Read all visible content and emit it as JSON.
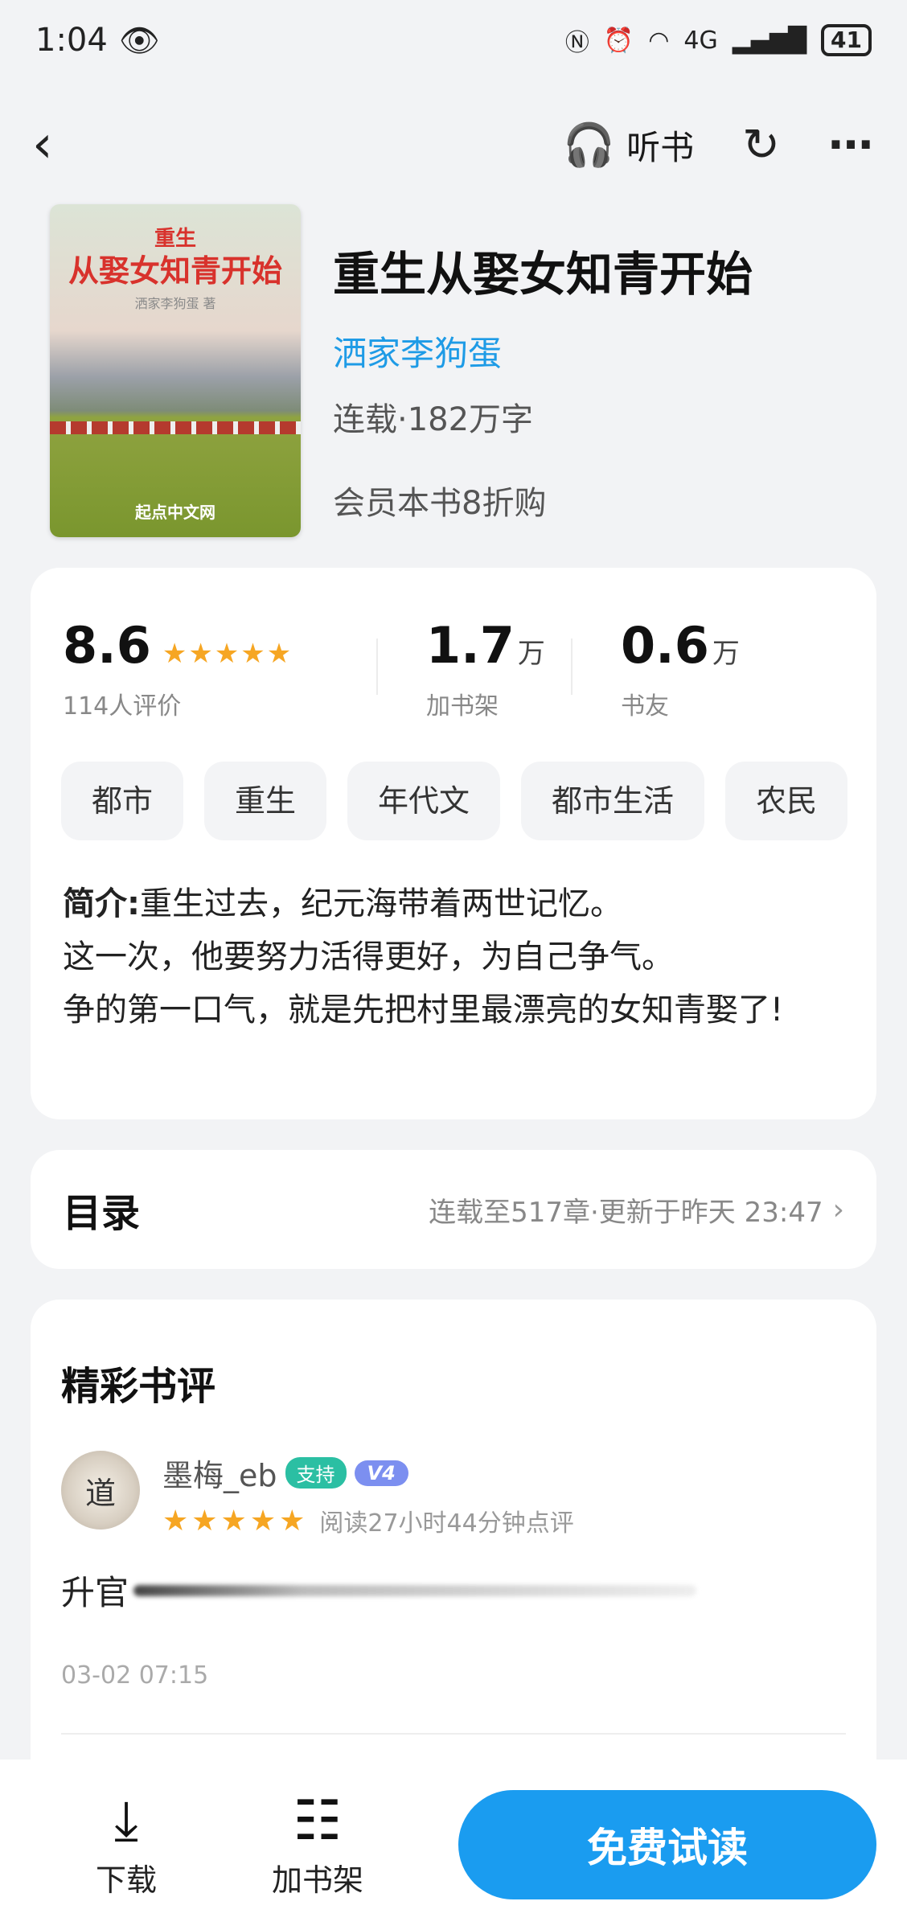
{
  "status_bar": {
    "time": "1:04",
    "battery": "41",
    "network": "4G"
  },
  "nav": {
    "listen_label": "听书"
  },
  "book": {
    "title": "重生从娶女知青开始",
    "author": "洒家李狗蛋",
    "meta": "连载·182万字",
    "promo": "会员本书8折购",
    "cover": {
      "subtitle": "重生",
      "title": "从娶女知青开始",
      "author": "洒家李狗蛋 著",
      "mark": "起点中文网"
    }
  },
  "stats": {
    "rating": "8.6",
    "rating_count_label": "114人评价",
    "stars_value": 4.5,
    "shelf_value": "1.7",
    "shelf_unit": "万",
    "shelf_label": "加书架",
    "friends_value": "0.6",
    "friends_unit": "万",
    "friends_label": "书友"
  },
  "tags": [
    "都市",
    "重生",
    "年代文",
    "都市生活",
    "农民"
  ],
  "intro": {
    "label": "简介:",
    "line1": "重生过去，纪元海带着两世记忆。",
    "line2": "这一次，他要努力活得更好，为自己争气。",
    "line3": "争的第一口气，就是先把村里最漂亮的女知青娶了!"
  },
  "toc": {
    "title": "目录",
    "info": "连载至517章·更新于昨天 23:47"
  },
  "reviews": {
    "title": "精彩书评",
    "items": [
      {
        "avatar_text": "道",
        "name": "墨梅_eb",
        "badge": "支持",
        "level": "V4",
        "stars": 5,
        "read_time": "阅读27小时44分钟点评",
        "text": "升官",
        "date": "03-02 07:15"
      }
    ]
  },
  "bottom": {
    "download_label": "下载",
    "shelf_label": "加书架",
    "read_label": "免费试读"
  },
  "colors": {
    "accent": "#1a9cf0",
    "author_link": "#1e9be6",
    "star": "#f6a623",
    "support_badge": "#2bbfa3"
  }
}
